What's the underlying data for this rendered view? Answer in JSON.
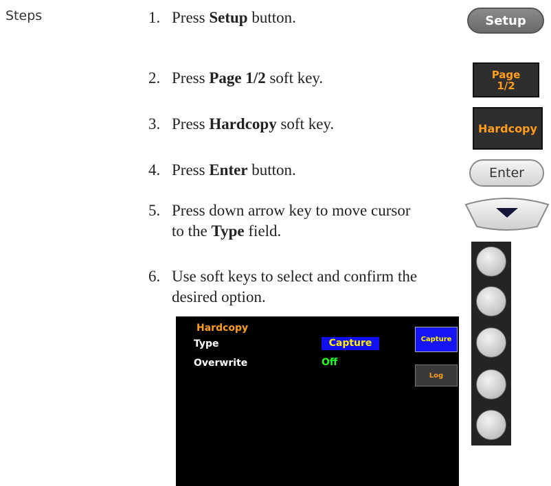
{
  "section_label": "Steps",
  "steps": [
    {
      "num": "1.",
      "pre": "Press ",
      "bold": "Setup",
      "post": " button."
    },
    {
      "num": "2.",
      "pre": "Press ",
      "bold": "Page 1/2",
      "post": " soft key."
    },
    {
      "num": "3.",
      "pre": "Press ",
      "bold": "Hardcopy",
      "post": " soft key."
    },
    {
      "num": "4.",
      "pre": "Press ",
      "bold": "Enter",
      "post": " button."
    },
    {
      "num": "5.",
      "pre": "Press down arrow key to move cursor to the ",
      "bold": "Type",
      "post": " field."
    },
    {
      "num": "6.",
      "pre": "Use soft keys to select and confirm the desired option.",
      "bold": "",
      "post": ""
    }
  ],
  "buttons": {
    "setup": "Setup",
    "page_line1": "Page",
    "page_line2": "1/2",
    "hardcopy": "Hardcopy",
    "enter": "Enter"
  },
  "screen": {
    "title": "Hardcopy",
    "rows": [
      {
        "label": "Type",
        "value": "Capture"
      },
      {
        "label": "Overwrite",
        "value": "Off"
      }
    ],
    "softkeys": [
      "Capture",
      "Log"
    ]
  },
  "colors": {
    "softkey_text": "#ff9d1a",
    "selected_bg": "#1010f0",
    "selected_text": "#ffee00",
    "value_green": "#22ff22"
  }
}
